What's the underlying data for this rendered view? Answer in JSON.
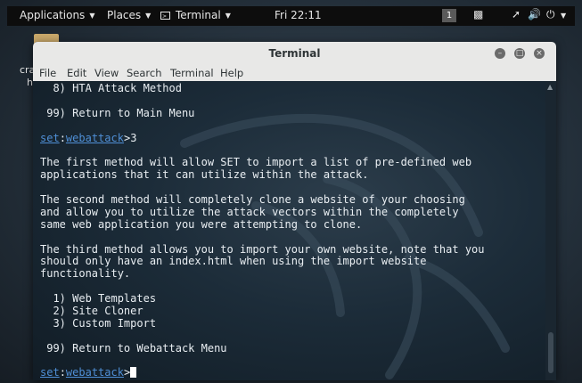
{
  "panel": {
    "applications": "Applications",
    "places": "Places",
    "terminal": "Terminal",
    "clock": "Fri 22:11",
    "workspace": "1"
  },
  "desktop": {
    "label_1": "cra",
    "label_2": "h"
  },
  "window": {
    "title": "Terminal",
    "menu": [
      "File",
      "Edit",
      "View",
      "Search",
      "Terminal",
      "Help"
    ]
  },
  "terminal": {
    "lines": [
      {
        "text": "  8) HTA Attack Method"
      },
      {
        "text": ""
      },
      {
        "text": " 99) Return to Main Menu"
      },
      {
        "text": ""
      },
      {
        "prompt": {
          "set": "set",
          "sep": ":",
          "module": "webattack",
          "arrow": ">"
        },
        "text": "3"
      },
      {
        "text": ""
      },
      {
        "text": "The first method will allow SET to import a list of pre-defined web"
      },
      {
        "text": "applications that it can utilize within the attack."
      },
      {
        "text": ""
      },
      {
        "text": "The second method will completely clone a website of your choosing"
      },
      {
        "text": "and allow you to utilize the attack vectors within the completely"
      },
      {
        "text": "same web application you were attempting to clone."
      },
      {
        "text": ""
      },
      {
        "text": "The third method allows you to import your own website, note that you"
      },
      {
        "text": "should only have an index.html when using the import website"
      },
      {
        "text": "functionality."
      },
      {
        "text": ""
      },
      {
        "text": "  1) Web Templates"
      },
      {
        "text": "  2) Site Cloner"
      },
      {
        "text": "  3) Custom Import"
      },
      {
        "text": ""
      },
      {
        "text": " 99) Return to Webattack Menu"
      },
      {
        "text": ""
      },
      {
        "prompt": {
          "set": "set",
          "sep": ":",
          "module": "webattack",
          "arrow": ">"
        },
        "text": "",
        "cursor": true
      }
    ]
  },
  "colors": {
    "prompt_accent": "#4f8fd6",
    "terminal_text": "#e9eef2",
    "titlebar": "#e8e8e7"
  }
}
